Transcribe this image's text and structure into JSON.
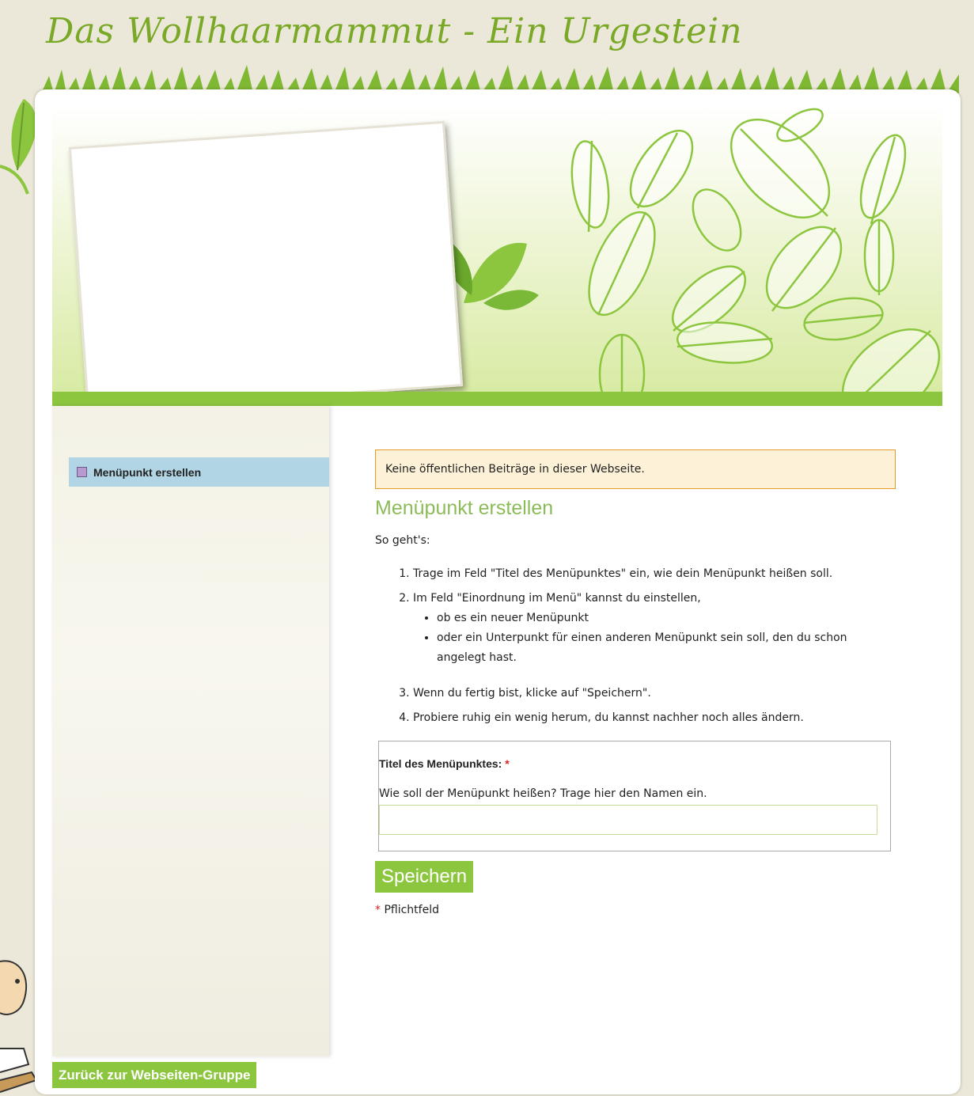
{
  "site": {
    "title": "Das Wollhaarmammut - Ein Urgestein"
  },
  "sidebar": {
    "items": [
      {
        "label": "Menüpunkt erstellen"
      }
    ],
    "back_label": "Zurück zur Webseiten-Gruppe"
  },
  "main": {
    "notice": "Keine öffentlichen Beiträge in dieser Webseite.",
    "heading": "Menüpunkt erstellen",
    "intro": "So geht's:",
    "steps": [
      "Trage im Feld \"Titel des Menüpunktes\" ein, wie dein Menüpunkt heißen soll.",
      "Im Feld \"Einordnung im Menü\" kannst du einstellen,",
      "Wenn du fertig bist, klicke auf \"Speichern\".",
      "Probiere ruhig ein wenig herum, du kannst nachher noch alles ändern."
    ],
    "sub_steps": [
      "ob es ein neuer Menüpunkt",
      "oder ein Unterpunkt für einen anderen Menüpunkt sein soll, den du schon angelegt hast."
    ],
    "form": {
      "title_label": "Titel des Menüpunktes:",
      "required_marker": "*",
      "title_description": "Wie soll der Menüpunkt heißen? Trage hier den Namen ein.",
      "title_value": ""
    },
    "save_label": "Speichern",
    "required_note": "Pflichtfeld"
  },
  "colors": {
    "accent_green": "#8cc63f",
    "heading_green": "#8cbc58",
    "menu_active_bg": "#b2d5e5",
    "notice_border": "#e59a2a",
    "notice_bg": "#fdf2d8"
  },
  "icons": [
    "leaf-icon",
    "menu-item-square-icon",
    "mascot-image"
  ]
}
